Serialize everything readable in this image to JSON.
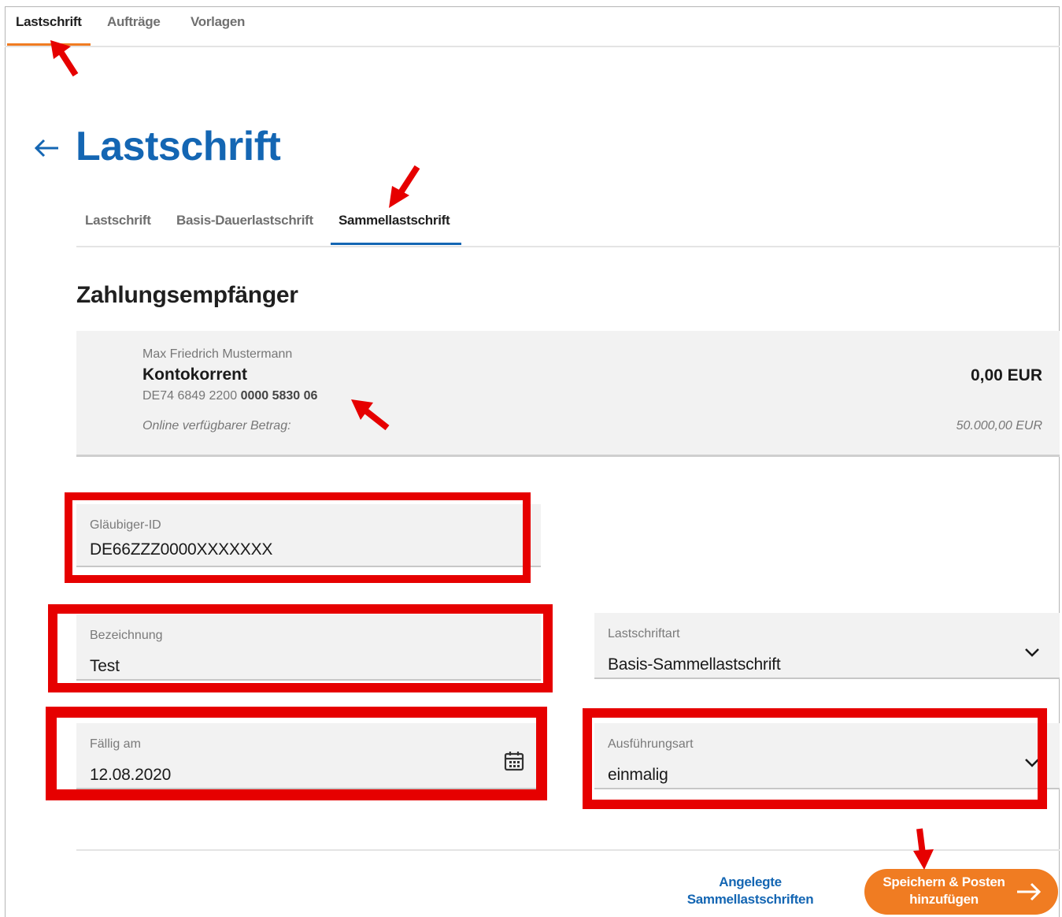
{
  "top_tabs": [
    {
      "label": "Lastschrift",
      "active": true
    },
    {
      "label": "Aufträge",
      "active": false
    },
    {
      "label": "Vorlagen",
      "active": false
    }
  ],
  "page": {
    "title": "Lastschrift",
    "back_icon": "arrow-left-icon"
  },
  "sub_tabs": [
    {
      "label": "Lastschrift",
      "active": false
    },
    {
      "label": "Basis-Dauerlastschrift",
      "active": false
    },
    {
      "label": "Sammellastschrift",
      "active": true
    }
  ],
  "section": {
    "title": "Zahlungsempfänger"
  },
  "account": {
    "holder": "Max Friedrich Mustermann",
    "name": "Kontokorrent",
    "iban_prefix": "DE74 6849 2200",
    "iban_suffix": "0000 5830 06",
    "balance": "0,00 EUR",
    "available_label": "Online verfügbarer Betrag:",
    "available_value": "50.000,00 EUR"
  },
  "form": {
    "glaeubiger_id": {
      "label": "Gläubiger-ID",
      "value": "DE66ZZZ0000XXXXXXX"
    },
    "bezeichnung": {
      "label": "Bezeichnung",
      "value": "Test"
    },
    "lastschriftart": {
      "label": "Lastschriftart",
      "value": "Basis-Sammellastschrift",
      "icon": "chevron-down-icon"
    },
    "faellig_am": {
      "label": "Fällig am",
      "value": "12.08.2020",
      "icon": "calendar-icon"
    },
    "ausfuehrungsart": {
      "label": "Ausführungsart",
      "value": "einmalig",
      "icon": "chevron-down-icon"
    }
  },
  "actions": {
    "secondary_line1": "Angelegte",
    "secondary_line2": "Sammellastschriften",
    "primary_line1": "Speichern & Posten",
    "primary_line2": "hinzufügen",
    "primary_icon": "arrow-right-icon"
  },
  "colors": {
    "brand_blue": "#1466b3",
    "accent_orange": "#f07c22",
    "annotation_red": "#e60000",
    "field_bg": "#f2f2f2"
  }
}
